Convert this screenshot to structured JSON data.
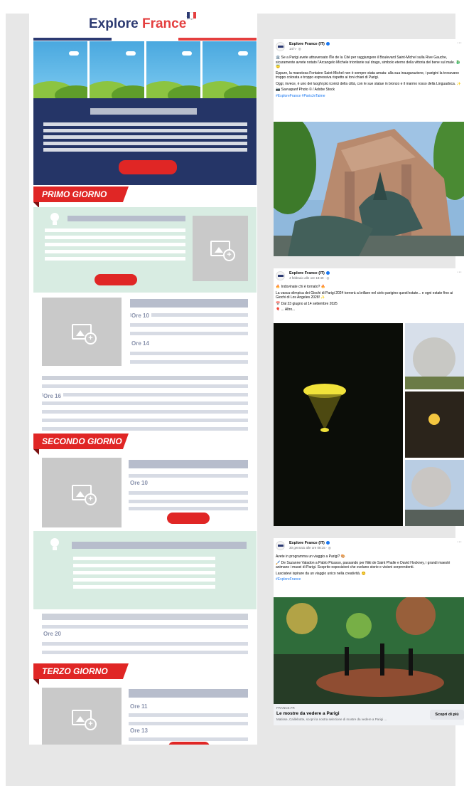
{
  "newsletter": {
    "logo_word1": "Explore",
    "logo_word2": "France",
    "logo_tm": "TM",
    "day1": "PRIMO GIORNO",
    "day2": "SECONDO GIORNO",
    "day3": "TERZO GIORNO",
    "times": [
      "Ore 10",
      "Ore 14",
      "Ore 16",
      "Ore 10",
      "Ore 20",
      "Ore 11",
      "Ore 13"
    ],
    "colors": {
      "navy": "#253567",
      "red": "#e02625",
      "mint": "#d8ece2",
      "placeholder": "#c9c9c9"
    }
  },
  "posts": [
    {
      "page": "Explore France (IT)",
      "date": "14 h · ◎",
      "paragraphs": [
        "🏛️ Se a Parigi avete attraversato l'Île de la Cité per raggiungere il Boulevard Saint-Michel sulla Rive Gauche, sicuramente avrete notato l'Arcangelo Michele trionfante sul drago, simbolo eterno della vittoria del bene sul male. 🐉😇",
        "Eppure, la maestosa Fontaine Saint-Michel non è sempre stata amata: alla sua inaugurazione, i parigini la trovavano troppo colorata e troppo espressiva rispetto ai toni chiari di Parigi.",
        "Oggi, invece, è uno dei luoghi più iconici della città, con le sue statue in bronzo e il marmo rosso della Linguadoca. ✨",
        "📷 Savvapanf Photo © / Adobe Stock"
      ],
      "hashtags": "#ExploreFrance #ParisJeTaime"
    },
    {
      "page": "Explore France (IT)",
      "date": "4 febbraio alle ore 18:49 · ◎",
      "paragraphs": [
        "🔥 Indovinate chi è tornato? 🔥",
        "La vasca olimpica dei Giochi di Parigi 2024 tornerà a brillare nel cielo parigino quest'estate... e ogni estate fino ai Giochi di Los Angeles 2028! ✨",
        "📅 Dal 23 giugno al 14 settembre 2025",
        "🎈 ... Altro..."
      ]
    },
    {
      "page": "Explore France (IT)",
      "date": "30 gennaio alle ore 08:15 · ◎",
      "paragraphs": [
        "Avete in programma un viaggio a Parigi? 🎨",
        "🖌️ De Suzanne Valadon a Pablo Picasso, passando per Niki de Saint Phalle e David Hockney, i grandi maestri animano i musei di Parigi. Scoprite esposizioni che svelano storie e visioni sorprendenti.",
        "Lasciatevi ispirare da un viaggio unico nella creatività. 😊"
      ],
      "hashtags": "#ExploreFrance",
      "link_domain": "FRANCE.FR",
      "link_title": "Le mostre da vedere a Parigi",
      "link_desc": "Matisse, Caillebotte, scopri la nostra selezione di mostre da vedere a Parigi ...",
      "link_button": "Scopri di più"
    }
  ]
}
